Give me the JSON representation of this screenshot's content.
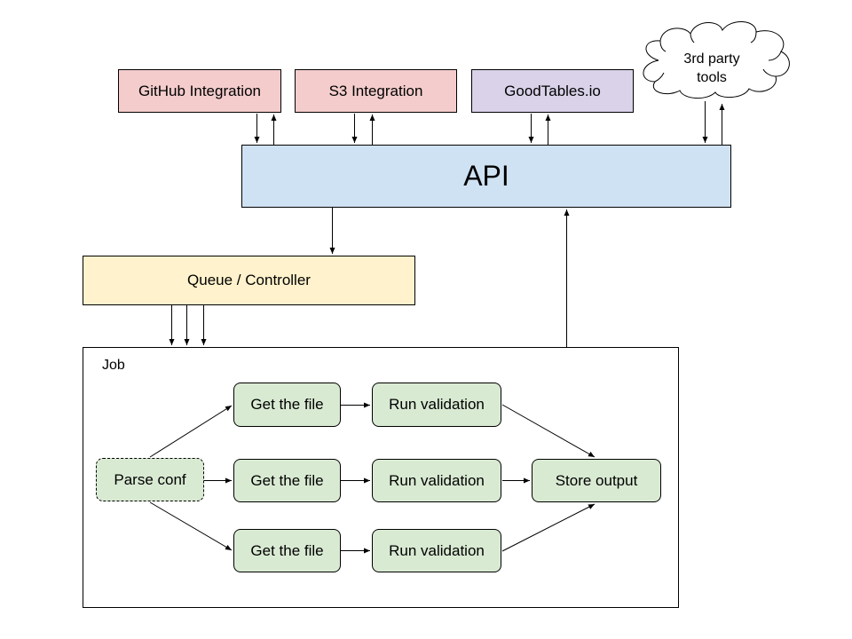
{
  "integrations": {
    "github": "GitHub Integration",
    "s3": "S3 Integration",
    "goodtables": "GoodTables.io",
    "third_party_line1": "3rd party",
    "third_party_line2": "tools"
  },
  "api": {
    "label": "API"
  },
  "queue": {
    "label": "Queue / Controller"
  },
  "job": {
    "title": "Job",
    "parse": "Parse conf",
    "get_file": [
      "Get the file",
      "Get the file",
      "Get the file"
    ],
    "run_validation": [
      "Run validation",
      "Run validation",
      "Run validation"
    ],
    "store": "Store output"
  },
  "colors": {
    "integration": "#f4cccc",
    "goodtables": "#d9d2e9",
    "api": "#cfe2f3",
    "queue": "#fff2cc",
    "job_step": "#d9ead3"
  }
}
